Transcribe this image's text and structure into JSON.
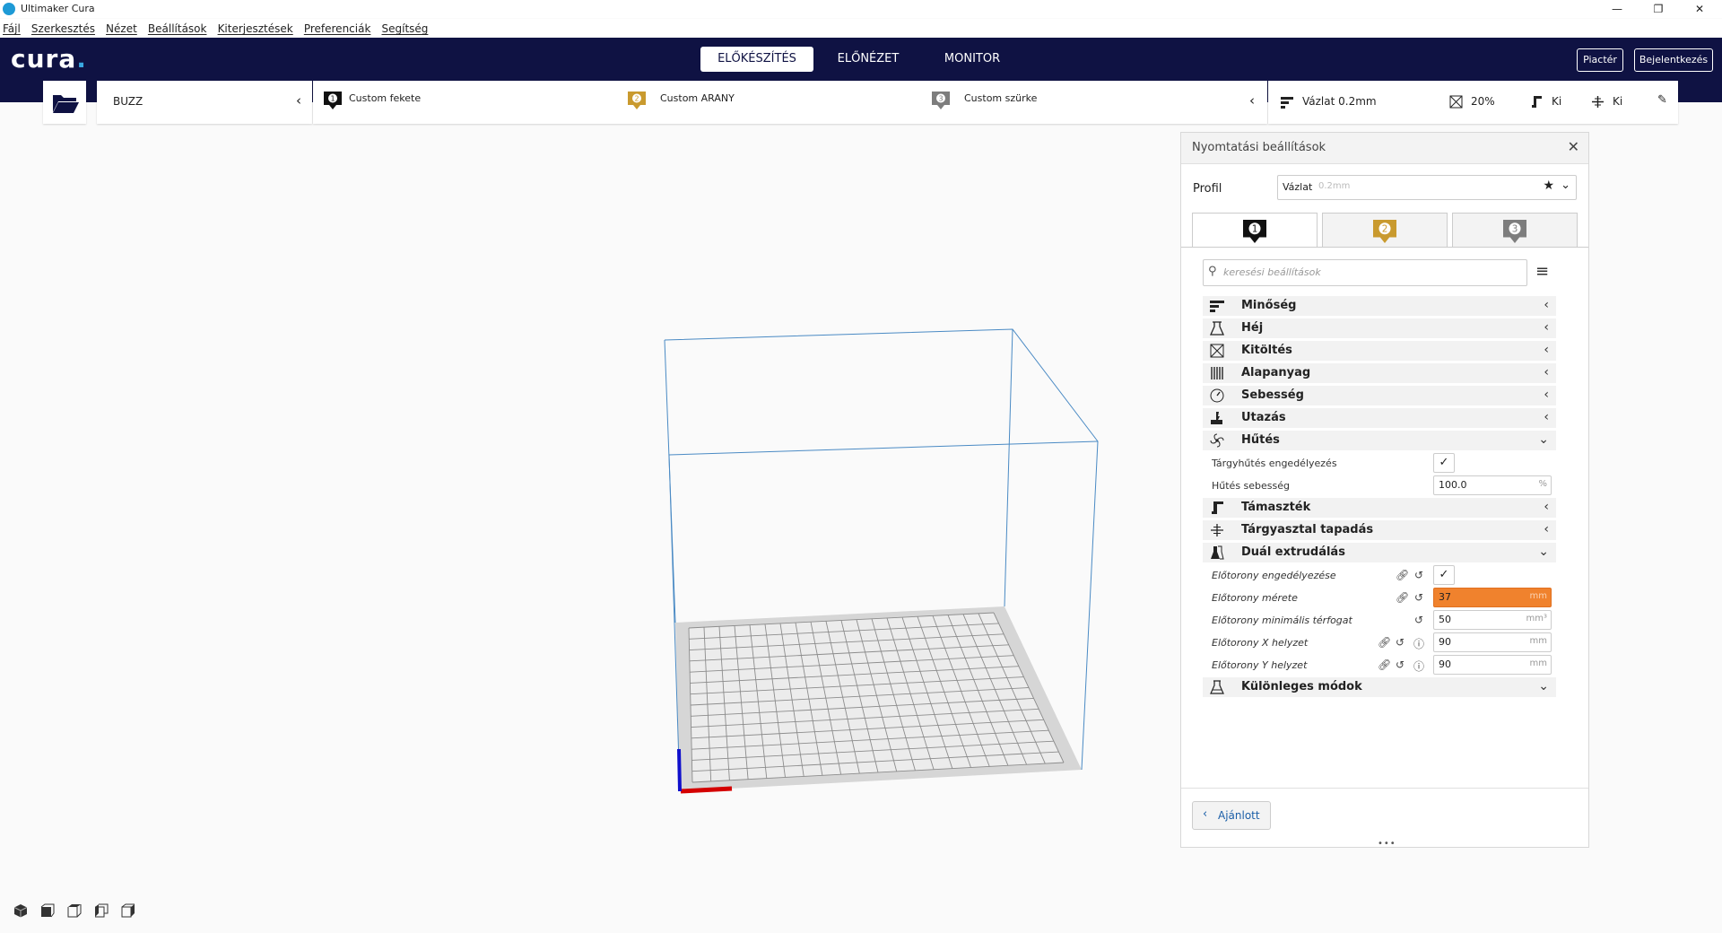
{
  "window": {
    "title": "Ultimaker Cura",
    "controls": [
      "—",
      "❐",
      "✕"
    ]
  },
  "menu": [
    "Fájl",
    "Szerkesztés",
    "Nézet",
    "Beállítások",
    "Kiterjesztések",
    "Preferenciák",
    "Segítség"
  ],
  "header": {
    "logo": "cura",
    "stages": [
      "ELŐKÉSZÍTÉS",
      "ELŐNÉZET",
      "MONITOR"
    ],
    "active_stage": "ELŐKÉSZÍTÉS",
    "marketplace": "Piactér",
    "login": "Bejelentkezés"
  },
  "toolbar": {
    "machine": "BUZZ",
    "extruders": [
      {
        "number": "1",
        "name": "Custom fekete",
        "color": "#111111"
      },
      {
        "number": "2",
        "name": "Custom ARANY",
        "color": "#c99a2e"
      },
      {
        "number": "3",
        "name": "Custom szürke",
        "color": "#7d7d7d"
      }
    ],
    "quality": "Vázlat 0.2mm",
    "infill": "20%",
    "support": "Ki",
    "adhesion": "Ki"
  },
  "panel": {
    "title": "Nyomtatási beállítások",
    "profile_label": "Profil",
    "profile_name": "Vázlat",
    "profile_suffix": "0.2mm",
    "extruder_tabs": [
      "1",
      "2",
      "3"
    ],
    "search_placeholder": "keresési beállítások",
    "categories": {
      "quality": "Minőség",
      "shell": "Héj",
      "infill": "Kitöltés",
      "material": "Alapanyag",
      "speed": "Sebesség",
      "travel": "Utazás",
      "cooling": "Hűtés",
      "support": "Támaszték",
      "adhesion": "Tárgyasztal tapadás",
      "dual": "Duál extrudálás",
      "special": "Különleges módok"
    },
    "cooling_settings": {
      "enable_label": "Tárgyhűtés engedélyezés",
      "enable_value": "✓",
      "speed_label": "Hűtés sebesség",
      "speed_value": "100.0",
      "speed_unit": "%"
    },
    "dual_settings": {
      "prime_enable_label": "Előtorony engedélyezése",
      "prime_enable_value": "✓",
      "prime_size_label": "Előtorony mérete",
      "prime_size_value": "37",
      "prime_size_unit": "mm",
      "prime_min_vol_label": "Előtorony minimális térfogat",
      "prime_min_vol_value": "50",
      "prime_min_vol_unit": "mm³",
      "prime_x_label": "Előtorony X helyzet",
      "prime_x_value": "90",
      "prime_x_unit": "mm",
      "prime_y_label": "Előtorony Y helyzet",
      "prime_y_value": "90",
      "prime_y_unit": "mm"
    },
    "recommended_button": "Ajánlott"
  },
  "colors": {
    "header_bg": "#0f1243",
    "accent_blue": "#39a8e0",
    "warning_orange": "#f0822d",
    "build_volume_line": "#4a8ac4"
  }
}
